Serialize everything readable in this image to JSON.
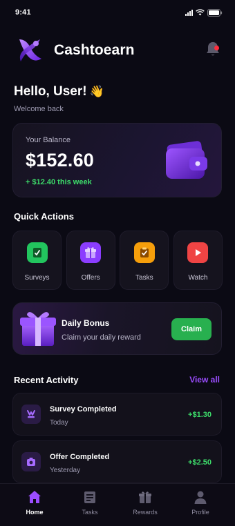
{
  "status_bar": {
    "time": "9:41"
  },
  "app": {
    "name": "Cashtoearn"
  },
  "greeting": {
    "title": "Hello, User!",
    "emoji": "👋",
    "subtitle": "Welcome back"
  },
  "balance": {
    "label": "Your Balance",
    "amount": "$152.60",
    "change": "+ $12.40 this week"
  },
  "quick_actions": {
    "title": "Quick Actions",
    "items": [
      {
        "label": "Surveys",
        "icon": "survey-icon",
        "color": "#22c55e"
      },
      {
        "label": "Offers",
        "icon": "gift-icon",
        "color": "#8b3dff"
      },
      {
        "label": "Tasks",
        "icon": "task-icon",
        "color": "#f59e0b"
      },
      {
        "label": "Watch",
        "icon": "play-icon",
        "color": "#ef4444"
      }
    ]
  },
  "daily_bonus": {
    "title": "Daily Bonus",
    "subtitle": "Claim your daily reward",
    "button": "Claim"
  },
  "recent_activity": {
    "title": "Recent Activity",
    "view_all": "View all",
    "items": [
      {
        "title": "Survey Completed",
        "date": "Today",
        "amount": "+$1.30",
        "icon": "survey-icon"
      },
      {
        "title": "Offer Completed",
        "date": "Yesterday",
        "amount": "+$2.50",
        "icon": "camera-icon"
      }
    ]
  },
  "bottom_nav": {
    "items": [
      {
        "label": "Home",
        "icon": "home-icon",
        "active": true
      },
      {
        "label": "Tasks",
        "icon": "tasks-icon",
        "active": false
      },
      {
        "label": "Rewards",
        "icon": "rewards-icon",
        "active": false
      },
      {
        "label": "Profile",
        "icon": "profile-icon",
        "active": false
      }
    ]
  },
  "colors": {
    "accent": "#8b3dff",
    "positive": "#3ddc6a",
    "background": "#0b0a14",
    "notification": "#ff2d3d"
  }
}
